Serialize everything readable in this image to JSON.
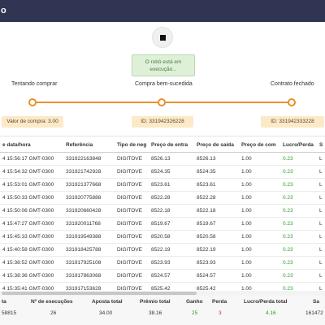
{
  "window": {
    "title": "o"
  },
  "control": {
    "stop_icon": "stop-square-icon"
  },
  "status": {
    "line1": "O robô está em",
    "line2": "execução..."
  },
  "steps": [
    {
      "label": "Tentando comprar"
    },
    {
      "label": "Compra bem-sucedida"
    },
    {
      "label": "Contrato fechado"
    }
  ],
  "pills": {
    "purchase_value": "Valor de compra: 3.00",
    "id_1": "ID: 331942326228",
    "id_2": "ID: 331942333228"
  },
  "colors": {
    "accent": "#e8912a",
    "header": "#2f3553",
    "green": "#2e9a2e",
    "red": "#c8302c"
  },
  "table": {
    "headers": [
      "e data/hora",
      "Referência",
      "Tipo de neg",
      "Preço de entra",
      "Preço de saída",
      "Preço de com",
      "Lucro/Perda",
      "S"
    ],
    "rows": [
      [
        "4 15:56:17 GMT-0300",
        "331922163848",
        "DIGITOVE",
        "8526.13",
        "8526.13",
        "1.00",
        "0.23",
        "L"
      ],
      [
        "4 15:54:32 GMT-0300",
        "331921742928",
        "DIGITOVE",
        "8524.35",
        "8524.35",
        "1.00",
        "0.23",
        "L"
      ],
      [
        "4 15:53:01 GMT-0300",
        "331921377668",
        "DIGITOVE",
        "8523.61",
        "8523.61",
        "1.00",
        "0.23",
        "L"
      ],
      [
        "4 15:50:33 GMT-0300",
        "331920775888",
        "DIGITOVE",
        "8522.28",
        "8522.28",
        "1.00",
        "0.23",
        "L"
      ],
      [
        "4 15:50:06 GMT-0300",
        "331920660428",
        "DIGITOVE",
        "8522.18",
        "8522.18",
        "1.00",
        "0.23",
        "L"
      ],
      [
        "4 15:47:27 GMT-0300",
        "331920011768",
        "DIGITOVE",
        "8519.67",
        "8519.67",
        "1.00",
        "0.23",
        "L"
      ],
      [
        "4 15:45:33 GMT-0300",
        "331919549388",
        "DIGITOVE",
        "8520.58",
        "8520.58",
        "1.00",
        "0.23",
        "L"
      ],
      [
        "4 15:40:58 GMT-0300",
        "331918425788",
        "DIGITOVE",
        "8522.19",
        "8522.19",
        "1.00",
        "0.23",
        "L"
      ],
      [
        "4 15:38:52 GMT-0300",
        "331917925108",
        "DIGITOVE",
        "8523.93",
        "8523.93",
        "1.00",
        "0.23",
        "L"
      ],
      [
        "4 15:38:36 GMT-0300",
        "331917863068",
        "DIGITOVE",
        "8524.57",
        "8524.57",
        "1.00",
        "0.23",
        "L"
      ],
      [
        "4 15:35:41 GMT-0300",
        "331917153628",
        "DIGITOVE",
        "8525.42",
        "8525.42",
        "1.00",
        "0.23",
        "L"
      ]
    ]
  },
  "summary": {
    "headers": [
      "ta",
      "Nº de execuções",
      "Aposta total",
      "Prêmio total",
      "Ganho",
      "Perda",
      "Lucro/Perda total",
      "Sa"
    ],
    "values": [
      "58815",
      "26",
      "34.00",
      "38.16",
      "25",
      "3",
      "4.16",
      "161472"
    ]
  }
}
